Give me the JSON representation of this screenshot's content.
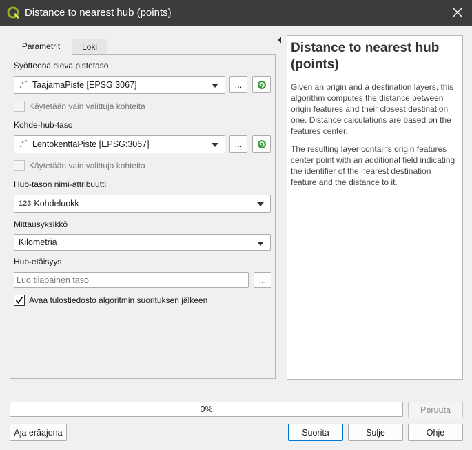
{
  "window": {
    "title": "Distance to nearest hub (points)"
  },
  "tabs": [
    {
      "label": "Parametrit"
    },
    {
      "label": "Loki"
    }
  ],
  "form": {
    "input_layer": {
      "label": "Syötteenä oleva pistetaso",
      "value": "TaajamaPiste [EPSG:3067]",
      "selected_only_label": "Käytetään vain valittuja kohteita"
    },
    "hub_layer": {
      "label": "Kohde-hub-taso",
      "value": "LentokenttaPiste [EPSG:3067]",
      "selected_only_label": "Käytetään vain valittuja kohteita"
    },
    "hub_name_attr": {
      "label": "Hub-tason nimi-attribuutti",
      "type_prefix": "123",
      "value": "Kohdeluokk"
    },
    "unit": {
      "label": "Mittausyksikkö",
      "value": "Kilometriä"
    },
    "hub_distance": {
      "label": "Hub-etäisyys",
      "placeholder": "Luo tilapäinen taso"
    },
    "open_output": {
      "label": "Avaa tulostiedosto algoritmin suorituksen jälkeen",
      "checked": true
    },
    "browse_label": "..."
  },
  "help": {
    "title": "Distance to nearest hub (points)",
    "paragraphs": [
      "Given an origin and a destination layers, this algorithm computes the distance between origin features and their closest destination one. Distance calculations are based on the features center.",
      "The resulting layer contains origin features center point with an additional field indicating the identifier of the nearest destination feature and the distance to it."
    ]
  },
  "progress": {
    "text": "0%",
    "value": 0
  },
  "buttons": {
    "cancel": "Peruuta",
    "batch": "Aja eräajona",
    "run": "Suorita",
    "close": "Sulje",
    "help": "Ohje"
  },
  "colors": {
    "titlebar": "#3c3c3c",
    "qgis_green": "#589632",
    "focus_blue": "#0078d7"
  }
}
